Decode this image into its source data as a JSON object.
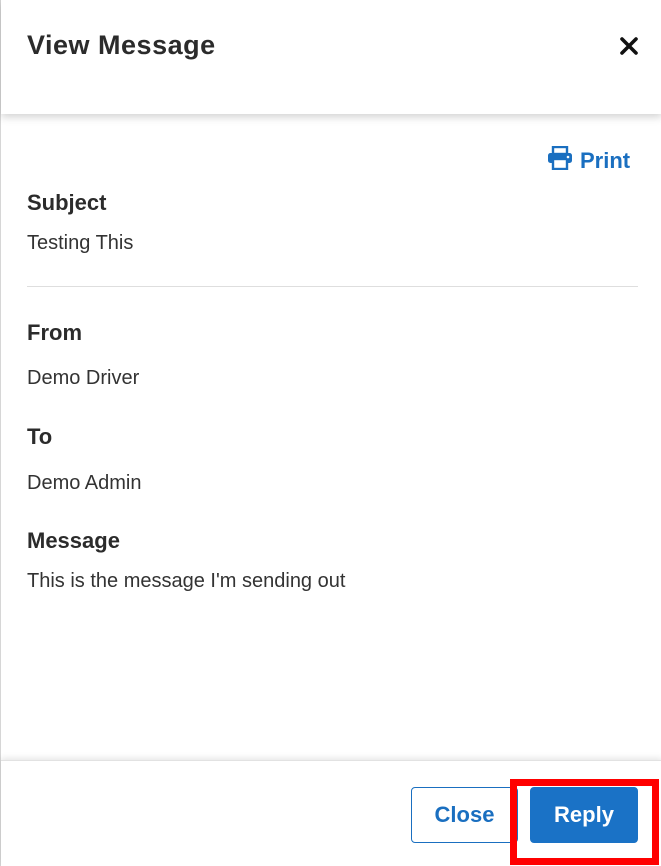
{
  "modal": {
    "title": "View Message",
    "close_icon": "close-x-icon"
  },
  "toolbar": {
    "print_label": "Print",
    "print_icon": "printer-icon"
  },
  "fields": {
    "subject_label": "Subject",
    "subject_value": "Testing This",
    "from_label": "From",
    "from_value": "Demo Driver",
    "to_label": "To",
    "to_value": "Demo Admin",
    "message_label": "Message",
    "message_value": "This is the message I'm sending out"
  },
  "footer": {
    "close_label": "Close",
    "reply_label": "Reply"
  },
  "colors": {
    "accent": "#1a6fc0",
    "highlight": "#ff0000"
  }
}
